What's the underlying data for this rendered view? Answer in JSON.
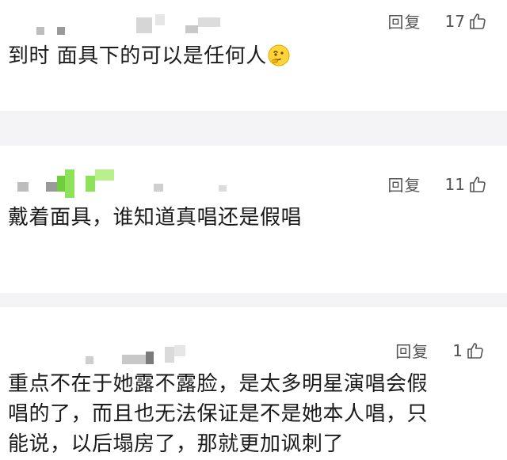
{
  "comments": [
    {
      "text": "到时 面具下的可以是任何人",
      "reply_label": "回复",
      "likes": "17",
      "emoji": "thinking-face"
    },
    {
      "text": "戴着面具，谁知道真唱还是假唱",
      "reply_label": "回复",
      "likes": "11"
    },
    {
      "text_lines": [
        "重点不在于她露不露脸，是太多明星演唱会假",
        "唱的了，而且也无法保证是不是她本人唱，只",
        "能说，以后塌房了，那就更加讽刺了"
      ],
      "reply_label": "回复",
      "likes": "1"
    }
  ],
  "colors": {
    "background": "#ffffff",
    "separator": "#f4f4f6",
    "text": "#1b1b1b",
    "meta": "#555555",
    "avatar_blur_green": "#7ddc4a"
  }
}
